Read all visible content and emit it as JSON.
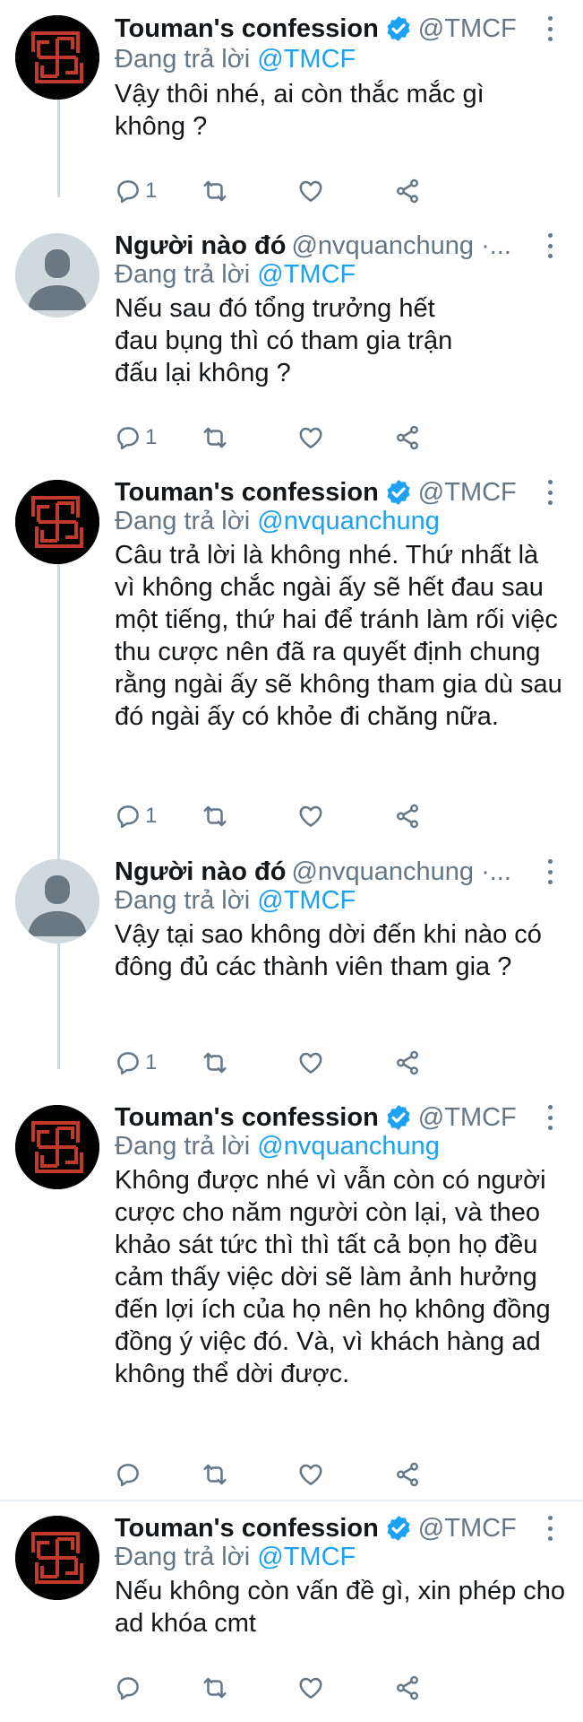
{
  "tweets": [
    {
      "name": "Touman's confession",
      "handle": "@TMCF",
      "replying_prefix": "Đang trả lời",
      "replying_to": "@TMCF",
      "text": "Vậy thôi nhé, ai còn thắc mắc gì không ?",
      "reply_count": "1"
    },
    {
      "name": "Người nào đó",
      "handle": "@nvquanchung ·...",
      "replying_prefix": "Đang trả lời",
      "replying_to": "@TMCF",
      "text": "Nếu sau đó tổng trưởng hết đau bụng thì có tham gia trận đấu lại không ?",
      "reply_count": "1"
    },
    {
      "name": "Touman's confession",
      "handle": "@TMCF",
      "replying_prefix": "Đang trả lời",
      "replying_to": "@nvquanchung",
      "text": "Câu trả lời là không nhé. Thứ nhất là vì không chắc ngài ấy sẽ hết đau sau một tiếng, thứ hai để tránh làm rối việc thu cược nên đã ra quyết định chung rằng ngài ấy sẽ không tham gia dù sau đó ngài ấy có khỏe đi chăng nữa.",
      "reply_count": "1"
    },
    {
      "name": "Người nào đó",
      "handle": "@nvquanchung ·...",
      "replying_prefix": "Đang trả lời",
      "replying_to": "@TMCF",
      "text": "Vậy tại sao không dời đến khi nào có đông đủ các thành viên tham gia ?",
      "reply_count": "1"
    },
    {
      "name": "Touman's confession",
      "handle": "@TMCF",
      "replying_prefix": "Đang trả lời",
      "replying_to": "@nvquanchung",
      "text": "Không được nhé vì vẫn còn có người cược cho năm người còn lại, và theo khảo sát tức thì thì tất cả bọn họ đều cảm thấy việc dời sẽ làm ảnh hưởng đến lợi ích của họ nên họ không đồng đồng ý việc đó. Và, vì khách hàng ad không thể dời được.",
      "reply_count": ""
    },
    {
      "name": "Touman's confession",
      "handle": "@TMCF",
      "replying_prefix": "Đang trả lời",
      "replying_to": "@TMCF",
      "text": "Nếu không còn vấn đề gì, xin phép cho ad khóa cmt",
      "reply_count": ""
    }
  ],
  "colors": {
    "text": "#14171a",
    "secondary": "#657786",
    "link": "#1da1f2",
    "verified": "#1da1f2",
    "thread_line": "#cfd9de",
    "logo_red": "#c0392b"
  },
  "icons": [
    "reply-icon",
    "retweet-icon",
    "like-icon",
    "share-icon",
    "more-icon",
    "verified-badge-icon"
  ]
}
